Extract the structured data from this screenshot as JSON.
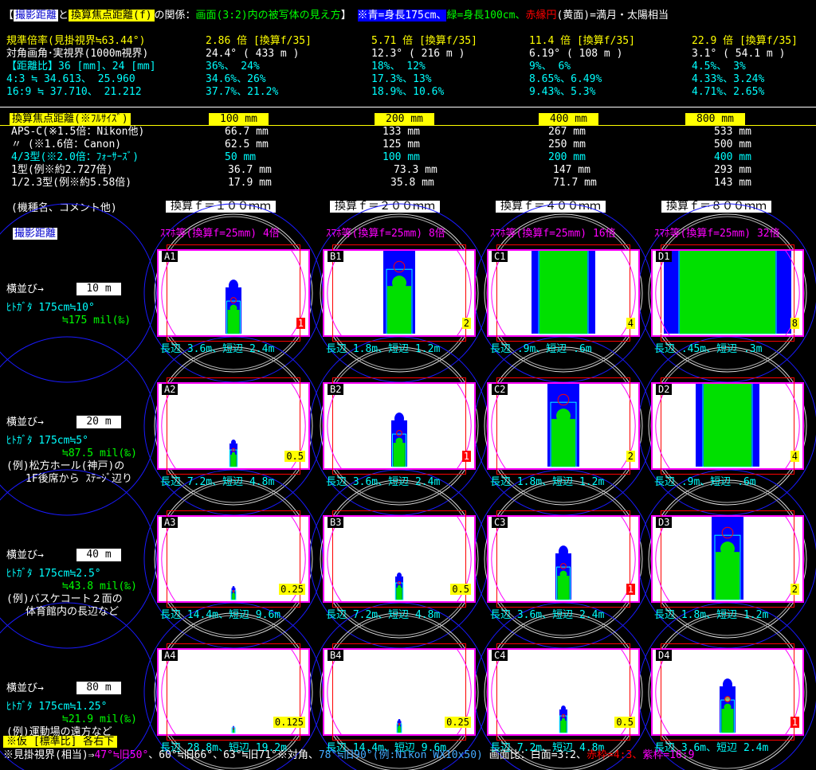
{
  "header": {
    "tag1": "撮影距離",
    "to": "と",
    "tag2": "換算焦点距離(f)",
    "rel": "の関係：",
    "desc": "画面(3:2)内の被写体の見え方",
    "note_a": "※青=身長175cm、",
    "note_b": "緑=身長100cm、",
    "note_c": "赤縁円",
    "note_d": "(黄面)=満月・太陽相当"
  },
  "spec_rows": [
    {
      "label": "規準倍率(見掛視界≒63.44°)",
      "v1": "2.86 倍 [換算f/35]",
      "v2": "5.71 倍 [換算f/35]",
      "v3": "11.4 倍 [換算f/35]",
      "v4": "22.9 倍 [換算f/35]"
    },
    {
      "label": "対角画角･実視界(1000m視界)",
      "v1": "24.4° ( 433 m )",
      "v2": "12.3° ( 216 m )",
      "v3": "6.19° ( 108 m )",
      "v4": "3.1° ( 54.1 m )"
    },
    {
      "label": "【距離比】36 [mm]、24 [mm]",
      "v1": "36%、  24%",
      "v2": "18%、  12%",
      "v3": "9%、   6%",
      "v4": "4.5%、  3%"
    },
    {
      "label": "  4:3 ≒ 34.613、 25.960",
      "v1": "34.6%、26%",
      "v2": "17.3%、13%",
      "v3": "8.65%、6.49%",
      "v4": "4.33%、3.24%"
    },
    {
      "label": " 16:9 ≒ 37.710、 21.212",
      "v1": "37.7%、21.2%",
      "v2": "18.9%、10.6%",
      "v3": "9.43%、5.3%",
      "v4": "4.71%、2.65%"
    }
  ],
  "focal_header": {
    "label": "換算焦点距離(※ﾌﾙｻｲｽﾞ)",
    "f1": "100 mm",
    "f2": "200 mm",
    "f3": "400 mm",
    "f4": "800 mm"
  },
  "sensor_rows": [
    {
      "label": "APS-C(※1.5倍：Nikon他)",
      "v1": "66.7 mm",
      "v2": "133 mm",
      "v3": "267 mm",
      "v4": "533 mm"
    },
    {
      "label": "  〃 (※1.6倍：Canon)",
      "v1": "62.5 mm",
      "v2": "125 mm",
      "v3": "250 mm",
      "v4": "500 mm"
    },
    {
      "label": "4/3型(※2.0倍：ﾌｫｰｻｰｽﾞ)",
      "v1": "50 mm",
      "v2": "100 mm",
      "v3": "200 mm",
      "v4": "400 mm"
    },
    {
      "label": "1型(例※約2.727倍)",
      "v1": "36.7 mm",
      "v2": "73.3 mm",
      "v3": "147 mm",
      "v4": "293 mm"
    },
    {
      "label": "1/2.3型(例※約5.58倍)",
      "v1": "17.9 mm",
      "v2": "35.8 mm",
      "v3": "71.7 mm",
      "v4": "143 mm"
    }
  ],
  "col_headers": {
    "model": "(機種名、コメント他)",
    "c1": "換算ｆ＝１００ｍｍ",
    "c2": "換算ｆ＝２００ｍｍ",
    "c3": "換算ｆ＝４００ｍｍ",
    "c4": "換算ｆ＝８００ｍｍ"
  },
  "dist_label": "撮影距離",
  "smartphone": [
    "ｽﾏﾎ等(換算f=25mm) 4倍",
    "ｽﾏﾎ等(換算f=25mm) 8倍",
    "ｽﾏﾎ等(換算f=25mm) 16倍",
    "ｽﾏﾎ等(換算f=25mm) 32倍"
  ],
  "rows": [
    {
      "side": "横並び→",
      "dist": "10 m",
      "p1": "ﾋﾄｶﾞﾀ 175cm≒10°",
      "p2": "≒175 mil(‰)",
      "ex1": "",
      "ex2": "",
      "cells": [
        {
          "id": "A1",
          "factor": "1",
          "red": true,
          "size": "長辺 3.6m、短辺 2.4m",
          "scale": 1
        },
        {
          "id": "B1",
          "factor": "2",
          "red": false,
          "size": "長辺 1.8m、短辺 1.2m",
          "scale": 2
        },
        {
          "id": "C1",
          "factor": "4",
          "red": false,
          "size": "長辺 .9m、短辺 .6m",
          "scale": 4
        },
        {
          "id": "D1",
          "factor": "8",
          "red": false,
          "size": "長辺 .45m、短辺 .3m",
          "scale": 8
        }
      ]
    },
    {
      "side": "横並び→",
      "dist": "20 m",
      "p1": "ﾋﾄｶﾞﾀ 175cm≒5°",
      "p2": "≒87.5 mil(‰)",
      "ex1": "(例)松方ホール(神戸)の",
      "ex2": "1F後席から ｽﾃｰｼﾞ辺り",
      "cells": [
        {
          "id": "A2",
          "factor": "0.5",
          "red": false,
          "size": "長辺 7.2m、短辺 4.8m",
          "scale": 0.5
        },
        {
          "id": "B2",
          "factor": "1",
          "red": true,
          "size": "長辺 3.6m、短辺 2.4m",
          "scale": 1
        },
        {
          "id": "C2",
          "factor": "2",
          "red": false,
          "size": "長辺 1.8m、短辺 1.2m",
          "scale": 2
        },
        {
          "id": "D2",
          "factor": "4",
          "red": false,
          "size": "長辺 .9m、短辺 .6m",
          "scale": 4
        }
      ]
    },
    {
      "side": "横並び→",
      "dist": "40 m",
      "p1": "ﾋﾄｶﾞﾀ 175cm≒2.5°",
      "p2": "≒43.8 mil(‰)",
      "ex1": "(例)バスケコート２面の",
      "ex2": "体育館内の長辺など",
      "cells": [
        {
          "id": "A3",
          "factor": "0.25",
          "red": false,
          "size": "長辺 14.4m、短辺 9.6m",
          "scale": 0.25
        },
        {
          "id": "B3",
          "factor": "0.5",
          "red": false,
          "size": "長辺 7.2m、短辺 4.8m",
          "scale": 0.5
        },
        {
          "id": "C3",
          "factor": "1",
          "red": true,
          "size": "長辺 3.6m、短辺 2.4m",
          "scale": 1
        },
        {
          "id": "D3",
          "factor": "2",
          "red": false,
          "size": "長辺 1.8m、短辺 1.2m",
          "scale": 2
        }
      ]
    },
    {
      "side": "横並び→",
      "dist": "80 m",
      "p1": "ﾋﾄｶﾞﾀ 175cm≒1.25°",
      "p2": "≒21.9 mil(‰)",
      "ex1": "(例)運動場の遠方など",
      "ex2": "",
      "cells": [
        {
          "id": "A4",
          "factor": "0.125",
          "red": false,
          "size": "長辺 28.8m、短辺 19.2m",
          "scale": 0.125
        },
        {
          "id": "B4",
          "factor": "0.25",
          "red": false,
          "size": "長辺 14.4m、短辺 9.6m",
          "scale": 0.25
        },
        {
          "id": "C4",
          "factor": "0.5",
          "red": false,
          "size": "長辺 7.2m、短辺 4.8m",
          "scale": 0.5
        },
        {
          "id": "D4",
          "factor": "1",
          "red": true,
          "size": "長辺 3.6m、短辺 2.4m",
          "scale": 1
        }
      ]
    }
  ],
  "footer": {
    "tag": "※仮 [標準比] 各右下",
    "l1": "※見掛視界(相当)⇒",
    "l2": "47°≒旧50°",
    "l3": "、60°≒旧66°、63°≒旧71°※対角、",
    "l4": "78°≒旧90°(例:Nikon WX10x50)",
    "l5": "画面比：白面=3:2、",
    "l6": "赤枠=4:3、",
    "l7": "紫枠=16:9"
  },
  "colors": {
    "blue_person": "#0000ff",
    "green_person": "#00e000",
    "magenta": "#ff00ff",
    "red": "#ff0000",
    "yellow": "#ffff00",
    "grid_blue": "#1a1aff"
  }
}
